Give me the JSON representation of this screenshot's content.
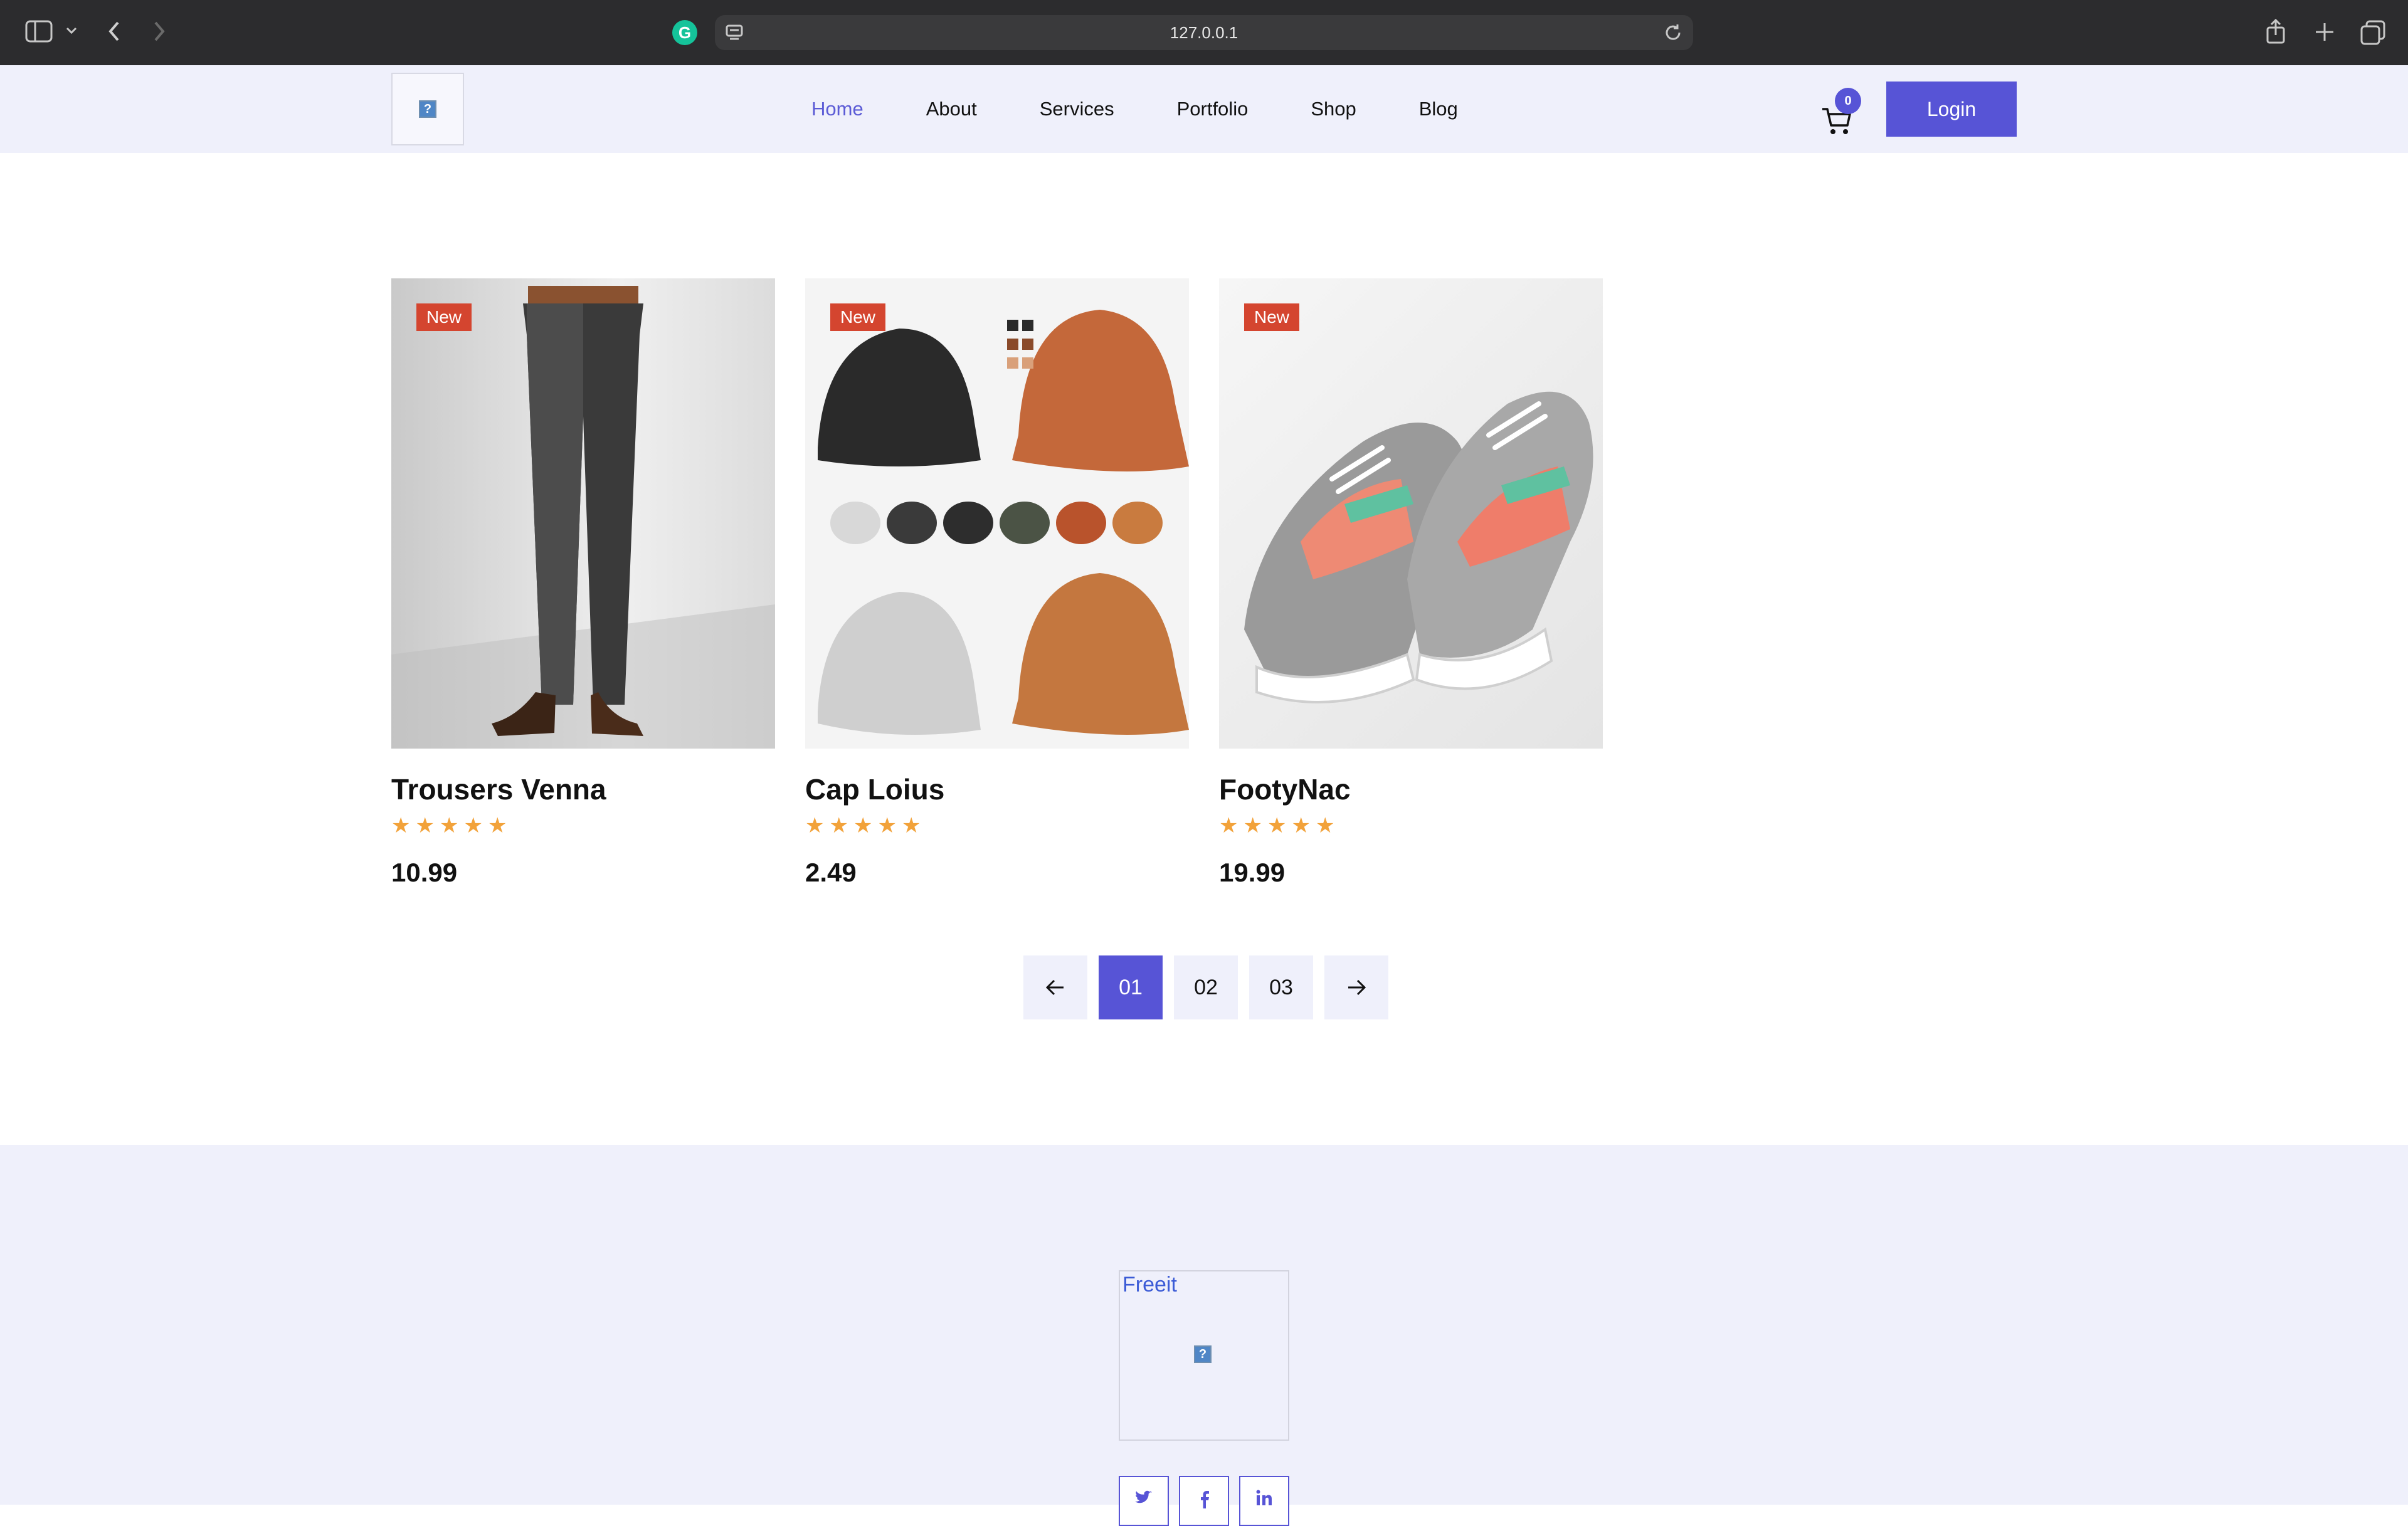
{
  "browser": {
    "url": "127.0.0.1",
    "icons": [
      "sidebar-icon",
      "chevron-down-icon",
      "back-icon",
      "forward-icon",
      "grammarly-icon",
      "site-icon",
      "reload-icon",
      "share-icon",
      "new-tab-icon",
      "tabs-icon"
    ]
  },
  "header": {
    "nav": [
      "Home",
      "About",
      "Services",
      "Portfolio",
      "Shop",
      "Blog"
    ],
    "active_nav": "Home",
    "cart_count": "0",
    "login_label": "Login"
  },
  "products": [
    {
      "name": "Trousers Venna",
      "price": "10.99",
      "badge": "New",
      "rating": 5
    },
    {
      "name": "Cap Loius",
      "price": "2.49",
      "badge": "New",
      "rating": 5
    },
    {
      "name": "FootyNac",
      "price": "19.99",
      "badge": "New",
      "rating": 5
    }
  ],
  "pagination": {
    "pages": [
      "01",
      "02",
      "03"
    ],
    "current": "01"
  },
  "footer": {
    "logo_alt": "Freeit",
    "socials": [
      "twitter-icon",
      "facebook-icon",
      "linkedin-icon"
    ]
  },
  "colors": {
    "accent": "#5754d6",
    "badge": "#d4452f",
    "star": "#f2a23a",
    "header_bg": "#eff0fb"
  }
}
